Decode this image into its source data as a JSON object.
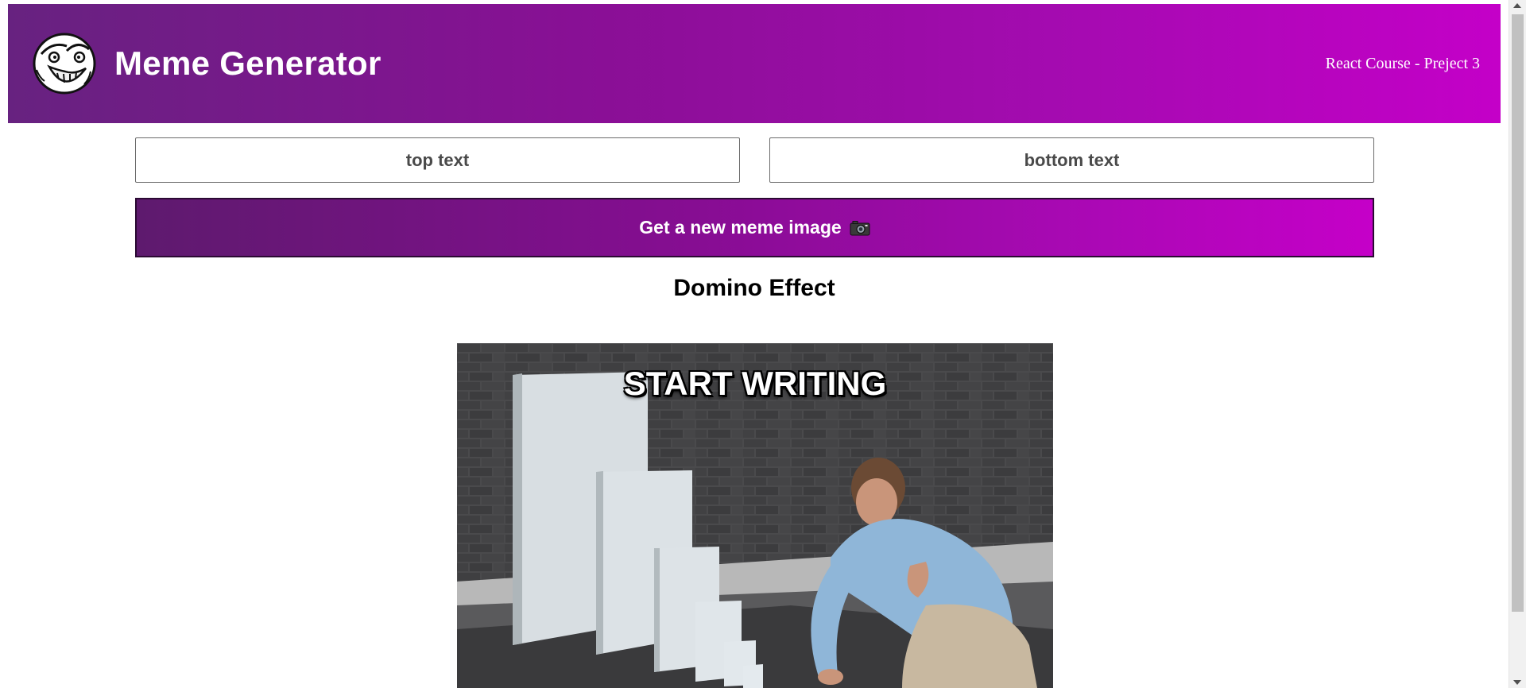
{
  "header": {
    "logo_icon": "troll-face-icon",
    "title": "Meme Generator",
    "course": "React Course - Preject 3",
    "gradient_start": "#672280",
    "gradient_end": "#c400c8"
  },
  "form": {
    "top_placeholder": "top text",
    "bottom_placeholder": "bottom text",
    "top_value": "",
    "bottom_value": "",
    "button_label": "Get a new meme image",
    "button_icon": "camera-icon"
  },
  "meme": {
    "name": "Domino Effect",
    "top_text": "START WRITING",
    "bottom_text": ""
  }
}
